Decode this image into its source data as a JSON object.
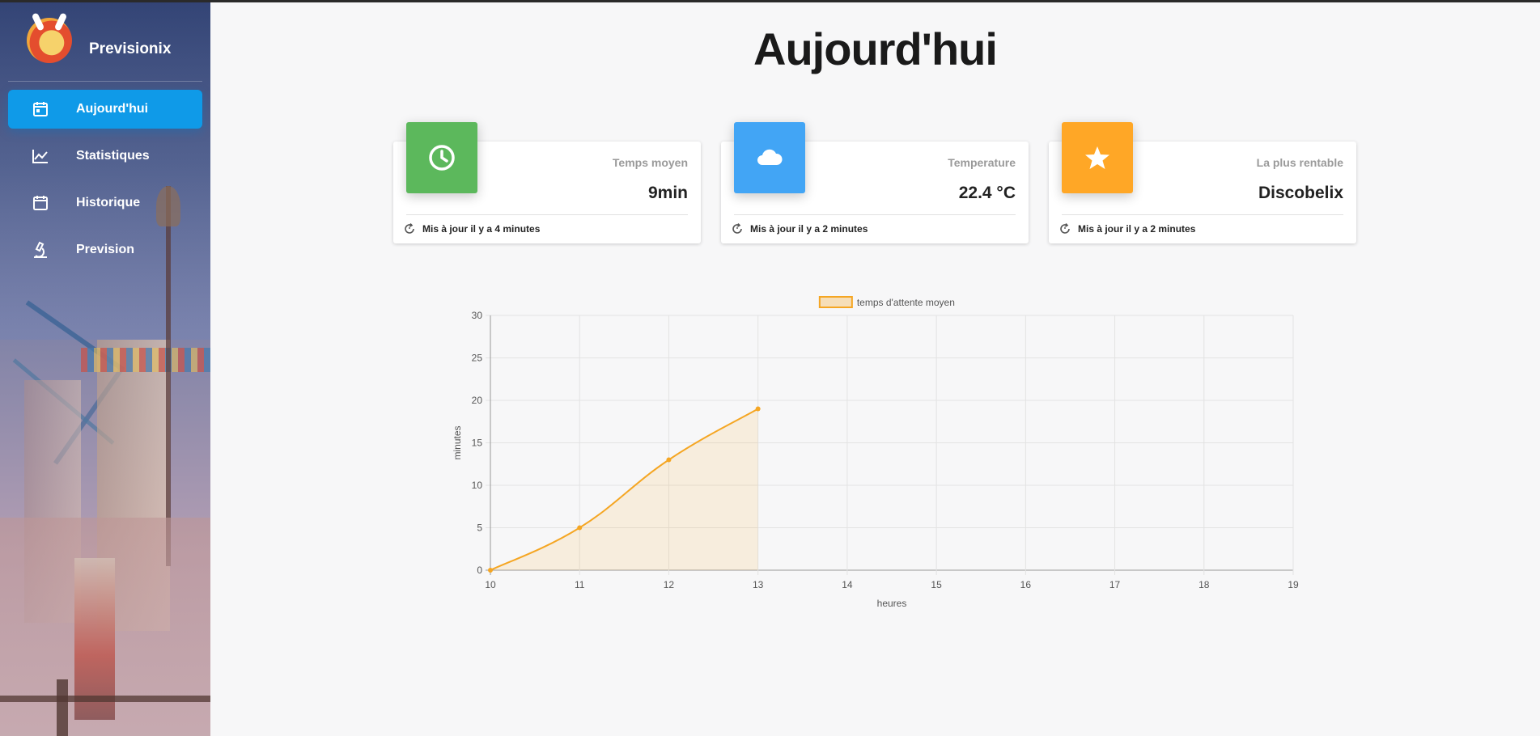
{
  "app": {
    "name": "Previsionix"
  },
  "sidebar": {
    "items": [
      {
        "label": "Aujourd'hui",
        "icon": "calendar-icon",
        "active": true
      },
      {
        "label": "Statistiques",
        "icon": "line-chart-icon",
        "active": false
      },
      {
        "label": "Historique",
        "icon": "calendar-icon",
        "active": false
      },
      {
        "label": "Prevision",
        "icon": "microscope-icon",
        "active": false
      }
    ]
  },
  "main": {
    "title": "Aujourd'hui",
    "cards": [
      {
        "title": "Temps moyen",
        "value": "9min",
        "footer": "Mis à jour il y a 4 minutes",
        "icon": "clock-icon",
        "color": "#5cb85c"
      },
      {
        "title": "Temperature",
        "value": "22.4 °C",
        "footer": "Mis à jour il y a 2 minutes",
        "icon": "cloud-icon",
        "color": "#42a5f5"
      },
      {
        "title": "La plus rentable",
        "value": "Discobelix",
        "footer": "Mis à jour il y a 2 minutes",
        "icon": "star-icon",
        "color": "#ffa726"
      }
    ]
  },
  "chart_data": {
    "type": "line",
    "x": [
      10,
      11,
      12,
      13
    ],
    "series": [
      {
        "name": "temps d'attente moyen",
        "values": [
          0,
          5,
          13,
          19
        ],
        "color": "#f5a623",
        "fill": "rgba(245,166,35,0.12)"
      }
    ],
    "x_ticks": [
      10,
      11,
      12,
      13,
      14,
      15,
      16,
      17,
      18,
      19
    ],
    "y_ticks": [
      0,
      5,
      10,
      15,
      20,
      25,
      30
    ],
    "xlim": [
      10,
      19
    ],
    "ylim": [
      0,
      30
    ],
    "xlabel": "heures",
    "ylabel": "minutes",
    "grid": true,
    "legend": "top"
  }
}
